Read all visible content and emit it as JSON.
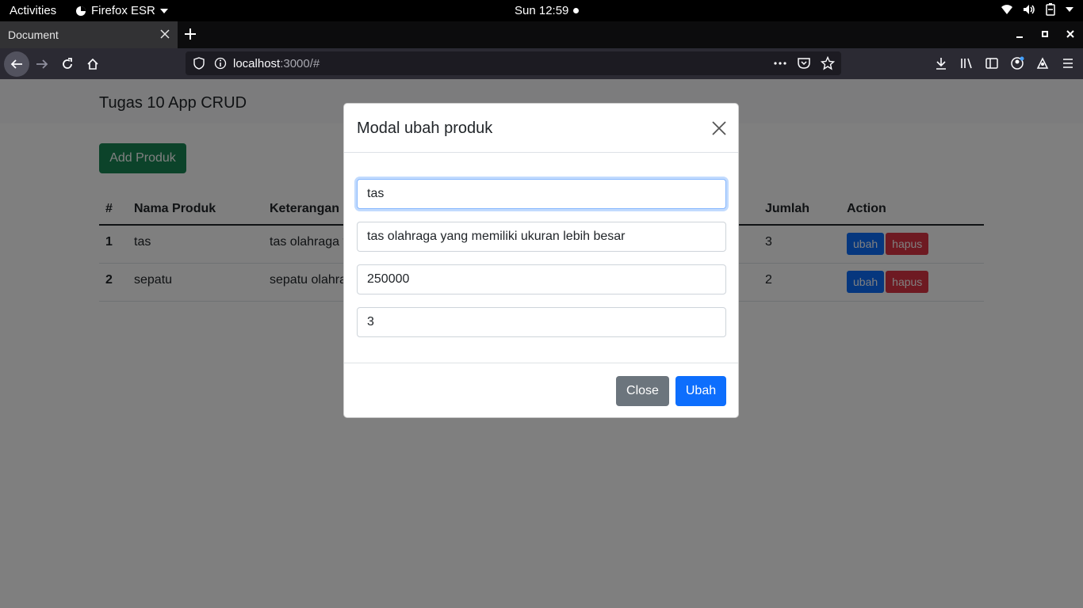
{
  "system": {
    "activities": "Activities",
    "app_name": "Firefox ESR",
    "clock": "Sun 12:59"
  },
  "browser": {
    "tab_title": "Document",
    "url_host": "localhost",
    "url_path": ":3000/#"
  },
  "app": {
    "brand": "Tugas 10 App CRUD",
    "add_button": "Add Produk",
    "table": {
      "headers": [
        "#",
        "Nama Produk",
        "Keterangan",
        "Jumlah",
        "Action"
      ],
      "rows": [
        {
          "no": "1",
          "nama": "tas",
          "keterangan": "tas olahraga y",
          "jumlah": "3",
          "edit": "ubah",
          "delete": "hapus"
        },
        {
          "no": "2",
          "nama": "sepatu",
          "keterangan": "sepatu olahra",
          "jumlah": "2",
          "edit": "ubah",
          "delete": "hapus"
        }
      ]
    }
  },
  "modal": {
    "title": "Modal ubah produk",
    "fields": {
      "nama": "tas",
      "keterangan": "tas olahraga yang memiliki ukuran lebih besar",
      "harga": "250000",
      "jumlah": "3"
    },
    "close_label": "Close",
    "submit_label": "Ubah"
  }
}
